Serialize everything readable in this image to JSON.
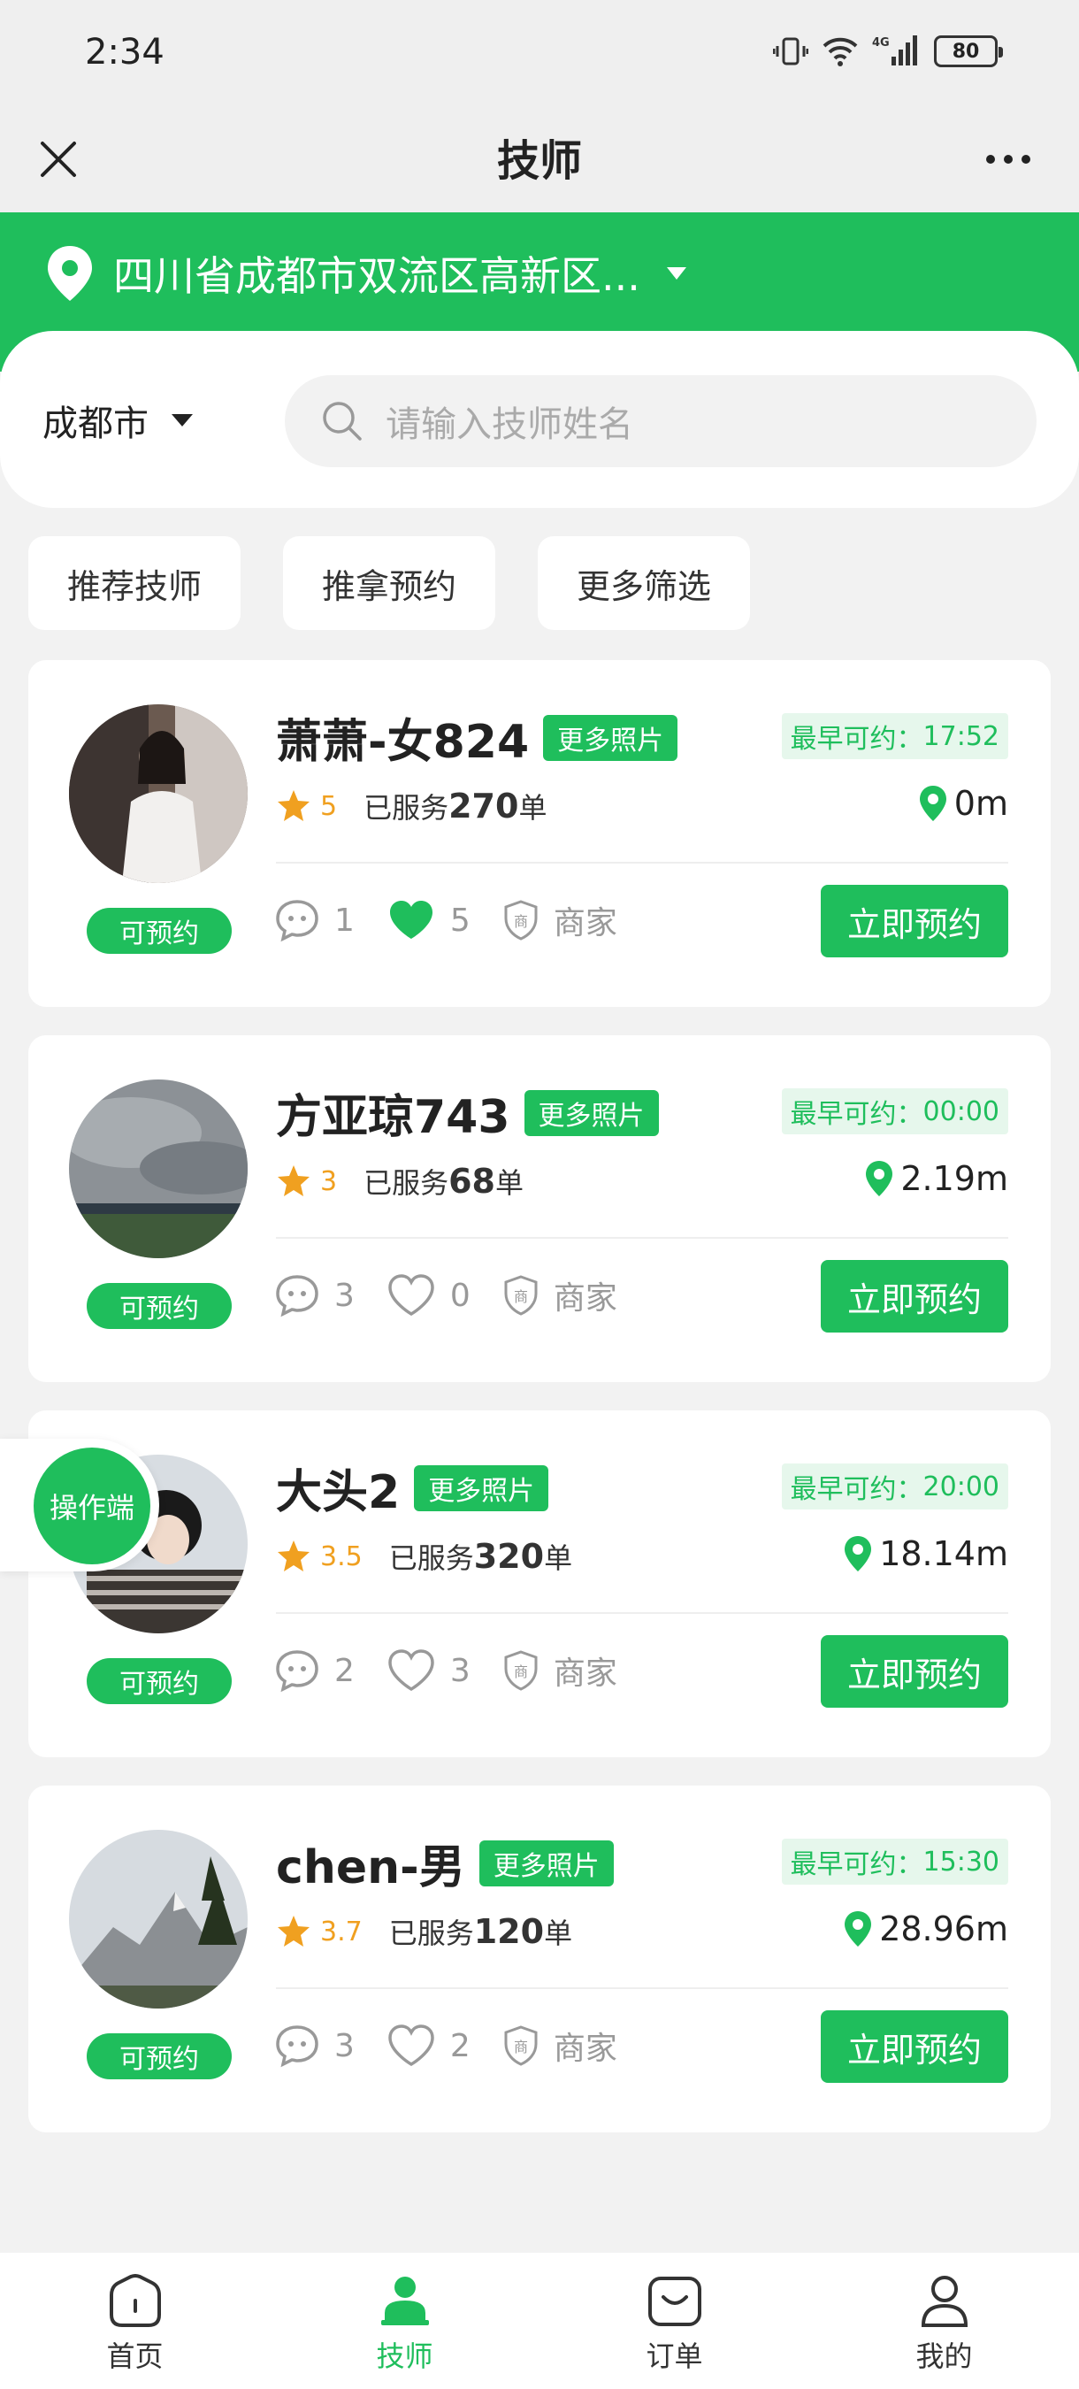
{
  "status_bar": {
    "time": "2:34",
    "battery": "80"
  },
  "nav": {
    "title": "技师"
  },
  "location": {
    "address": "四川省成都市双流区高新区..."
  },
  "search": {
    "city": "成都市",
    "placeholder": "请输入技师姓名"
  },
  "filters": [
    "推荐技师",
    "推拿预约",
    "更多筛选"
  ],
  "labels": {
    "more_photos": "更多照片",
    "available": "可预约",
    "book_now": "立即预约",
    "served_prefix": "已服务",
    "served_suffix": "单",
    "merchant": "商家",
    "earliest_prefix": "最早可约："
  },
  "technicians": [
    {
      "name": "萧萧-女824",
      "rating": "5",
      "served": "270",
      "earliest": "17:52",
      "distance": "0m",
      "comments": "1",
      "likes": "5",
      "liked": true
    },
    {
      "name": "方亚琼743",
      "rating": "3",
      "served": "68",
      "earliest": "00:00",
      "distance": "2.19m",
      "comments": "3",
      "likes": "0",
      "liked": false
    },
    {
      "name": "大头2",
      "rating": "3.5",
      "served": "320",
      "earliest": "20:00",
      "distance": "18.14m",
      "comments": "2",
      "likes": "3",
      "liked": false
    },
    {
      "name": "chen-男",
      "rating": "3.7",
      "served": "120",
      "earliest": "15:30",
      "distance": "28.96m",
      "comments": "3",
      "likes": "2",
      "liked": false
    }
  ],
  "floating": {
    "operator": "操作端"
  },
  "bottom_nav": [
    {
      "label": "首页",
      "icon": "home-icon"
    },
    {
      "label": "技师",
      "icon": "technician-icon",
      "active": true
    },
    {
      "label": "订单",
      "icon": "orders-icon"
    },
    {
      "label": "我的",
      "icon": "profile-icon"
    }
  ],
  "colors": {
    "accent": "#1fbe5c",
    "star": "#f0a020",
    "background": "#f2f2f2"
  }
}
